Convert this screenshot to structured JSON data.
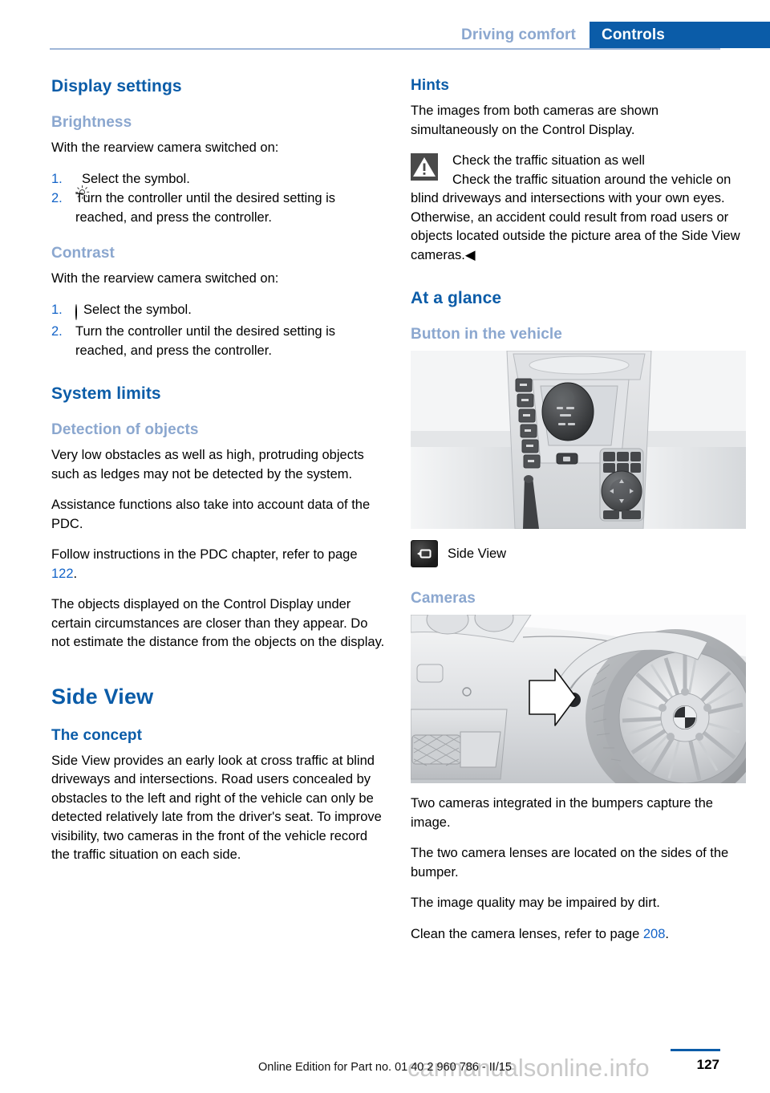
{
  "header": {
    "chapter": "Driving comfort",
    "section": "Controls"
  },
  "left_column": {
    "title": "Display settings",
    "brightness": {
      "heading": "Brightness",
      "intro": "With the rearview camera switched on:",
      "steps": [
        {
          "num": "1.",
          "icon": "brightness-sun-icon",
          "text": "Select the symbol."
        },
        {
          "num": "2.",
          "icon": "",
          "text": "Turn the controller until the desired setting is reached, and press the controller."
        }
      ]
    },
    "contrast": {
      "heading": "Contrast",
      "intro": "With the rearview camera switched on:",
      "steps": [
        {
          "num": "1.",
          "icon": "contrast-icon",
          "text": "Select the symbol."
        },
        {
          "num": "2.",
          "icon": "",
          "text": "Turn the controller until the desired setting is reached, and press the controller."
        }
      ]
    },
    "system_limits": {
      "heading": "System limits",
      "detection_heading": "Detection of objects",
      "paragraphs": [
        "Very low obstacles as well as high, protruding objects such as ledges may not be detected by the system.",
        "Assistance functions also take into account data of the PDC."
      ],
      "pdc_ref_prefix": "Follow instructions in the PDC chapter, refer to page ",
      "pdc_ref_page": "122",
      "pdc_ref_suffix": ".",
      "closing": "The objects displayed on the Control Display under certain circumstances are closer than they appear. Do not estimate the distance from the objects on the display."
    },
    "side_view": {
      "title": "Side View",
      "concept_heading": "The concept",
      "concept_text": "Side View provides an early look at cross traffic at blind driveways and intersections. Road users concealed by obstacles to the left and right of the vehicle can only be detected relatively late from the driver's seat. To improve visibility, two cameras in the front of the vehicle record the traffic situation on each side."
    }
  },
  "right_column": {
    "hints": {
      "heading": "Hints",
      "intro": "The images from both cameras are shown simultaneously on the Control Display.",
      "warning_icon": "warning-triangle-icon",
      "warning_title": "Check the traffic situation as well",
      "warning_body": "Check the traffic situation around the vehicle on blind driveways and intersections with your own eyes. Otherwise, an accident could result from road users or objects located outside the picture area of the Side View cameras.◀"
    },
    "at_a_glance": {
      "heading": "At a glance",
      "button_heading": "Button in the vehicle",
      "console_figure_alt": "vehicle-center-console-illustration",
      "button_icon": "side-view-camera-icon",
      "button_label": "Side View"
    },
    "cameras": {
      "heading": "Cameras",
      "figure_alt": "vehicle-front-bumper-camera-illustration",
      "paragraphs": [
        "Two cameras integrated in the bumpers capture the image.",
        "The two camera lenses are located on the sides of the bumper.",
        "The image quality may be impaired by dirt."
      ],
      "clean_ref_prefix": "Clean the camera lenses, refer to page ",
      "clean_ref_page": "208",
      "clean_ref_suffix": "."
    }
  },
  "footer": {
    "edition_note": "Online Edition for Part no. 01 40 2 960 786 - II/15",
    "page_number": "127",
    "watermark": "carmanualsonline.info"
  },
  "colors": {
    "accent_blue": "#0b5ca8",
    "light_blue": "#8ba7cf",
    "link_blue": "#1464c8",
    "rule_blue": "#9fb6d8"
  }
}
